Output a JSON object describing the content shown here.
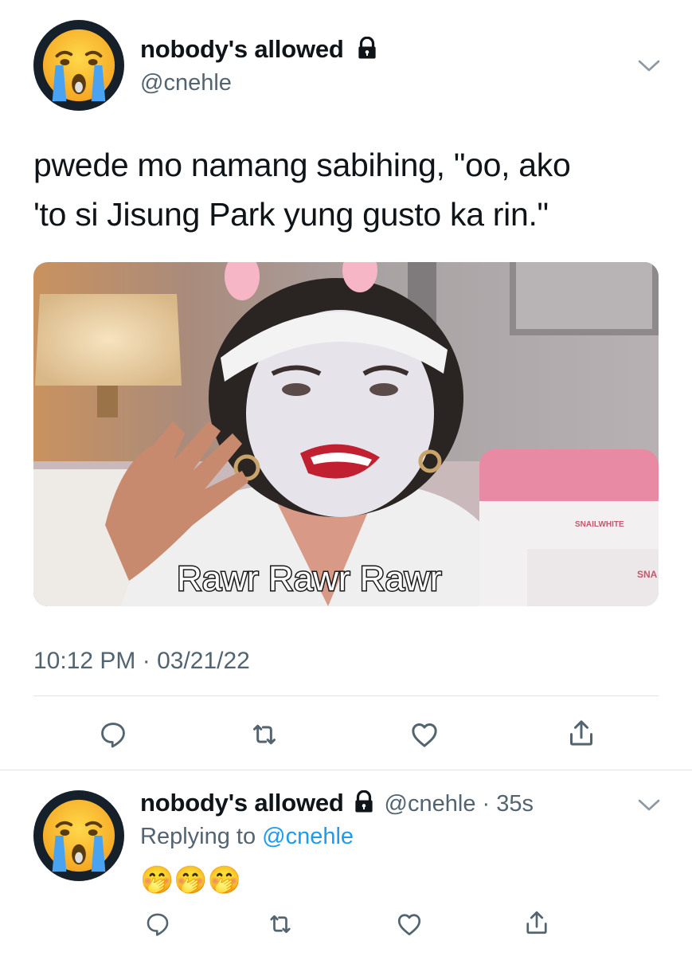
{
  "main_tweet": {
    "display_name": "nobody's allowed",
    "handle": "@cnehle",
    "avatar_icon": "crying-face-emoji",
    "text_line1": "pwede mo namang sabihing, \"oo, ako",
    "text_line2": "'to si Jisung Park yung gusto ka rin.\"",
    "media": {
      "caption": "Rawr Rawr Rawr",
      "product_box_label": "SNAILWHITE",
      "product_box_label_2": "SNA"
    },
    "timestamp": "10:12 PM · 03/21/22",
    "actions": [
      "reply-icon",
      "retweet-icon",
      "like-icon",
      "share-icon"
    ]
  },
  "reply_tweet": {
    "display_name": "nobody's allowed",
    "handle_time": "@cnehle · 35s",
    "replying_prefix": "Replying to",
    "replying_handle": "@cnehle",
    "emojis": "🤭🤭🤭",
    "avatar_icon": "crying-face-emoji",
    "actions": [
      "reply-icon",
      "retweet-icon",
      "like-icon",
      "share-icon"
    ]
  },
  "colors": {
    "link": "#1d9bf0",
    "secondary_text": "#536471",
    "avatar_bg": "#15202b"
  }
}
